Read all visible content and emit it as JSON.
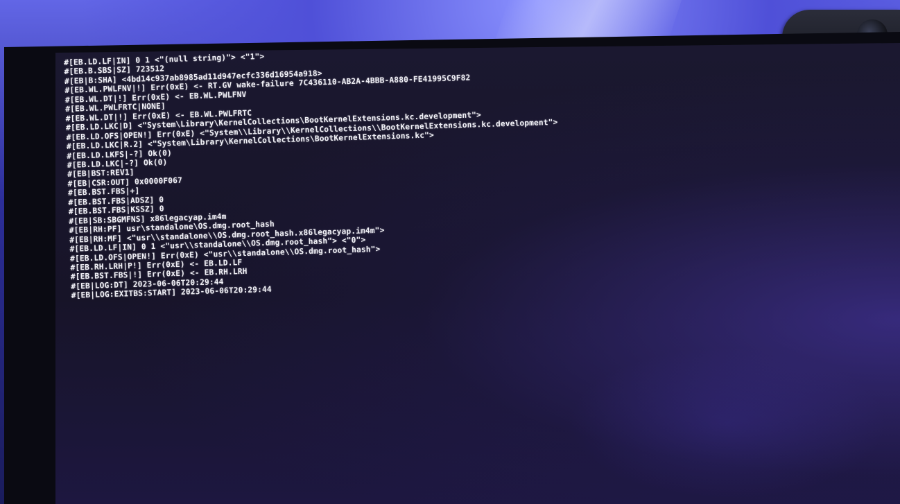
{
  "console": {
    "lines": [
      "#[EB.LD.LF|IN] 0 1 <\"(null string)\"> <\"1\">",
      "#[EB.B.SBS|SZ] 723512",
      "#[EB|B:SHA] <4bd14c937ab8985ad11d947ecfc336d16954a918>",
      "#[EB.WL.PWLFNV|!] Err(0xE) <- RT.GV wake-failure 7C436110-AB2A-4BBB-A880-FE41995C9F82",
      "#[EB.WL.DT|!] Err(0xE) <- EB.WL.PWLFNV",
      "#[EB.WL.PWLFRTC|NONE]",
      "#[EB.WL.DT|!] Err(0xE) <- EB.WL.PWLFRTC",
      "#[EB.LD.LKC|D] <\"System\\Library\\KernelCollections\\BootKernelExtensions.kc.development\">",
      "#[EB.LD.OFS|OPEN!] Err(0xE) <\"System\\\\Library\\\\KernelCollections\\\\BootKernelExtensions.kc.development\">",
      "#[EB.LD.LKC|R.2] <\"System\\Library\\KernelCollections\\BootKernelExtensions.kc\">",
      "#[EB.LD.LKFS|-?] Ok(0)",
      "#[EB.LD.LKC|-?] Ok(0)",
      "#[EB|BST:REV1]",
      "#[EB|CSR:OUT] 0x0000F067",
      "#[EB.BST.FBS|+]",
      "#[EB.BST.FBS|ADSZ] 0",
      "#[EB.BST.FBS|KSSZ] 0",
      "#[EB|SB:SBGMFNS] x86legacyap.im4m",
      "#[EB|RH:PF] usr\\standalone\\OS.dmg.root_hash",
      "#[EB|RH:MF] <\"usr\\\\standalone\\\\OS.dmg.root_hash.x86legacyap.im4m\">",
      "#[EB.LD.LF|IN] 0 1 <\"usr\\\\standalone\\\\OS.dmg.root_hash\"> <\"0\">",
      "#[EB.LD.OFS|OPEN!] Err(0xE) <\"usr\\\\standalone\\\\OS.dmg.root_hash\">",
      "#[EB.RH.LRH|P!] Err(0xE) <- EB.LD.LF",
      "#[EB.BST.FBS|!] Err(0xE) <- EB.RH.LRH",
      "#[EB|LOG:DT] 2023-06-06T20:29:44",
      "#[EB|LOG:EXITBS:START] 2023-06-06T20:29:44"
    ]
  }
}
